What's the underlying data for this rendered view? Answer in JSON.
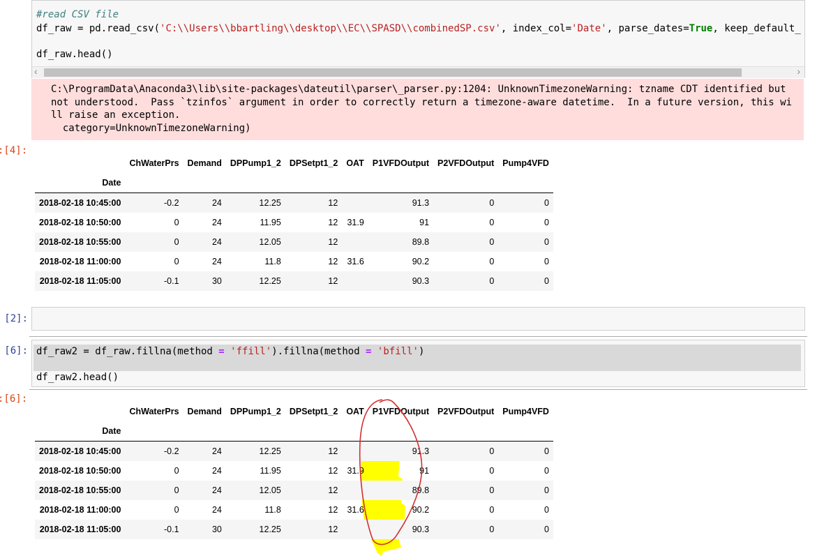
{
  "cell_read": {
    "comment": "#read CSV file",
    "line1_prefix": "df_raw = pd.read_csv(",
    "line1_path": "'C:\\\\Users\\\\bbartling\\\\desktop\\\\EC\\\\SPASD\\\\combinedSP.csv'",
    "line1_mid1": ", index_col=",
    "line1_index": "'Date'",
    "line1_mid2": ", parse_dates=",
    "line1_true": "True",
    "line1_mid3": ", keep_default_",
    "line2": "df_raw.head()",
    "scroll_right": "›",
    "scroll_left": "‹",
    "warning": "C:\\ProgramData\\Anaconda3\\lib\\site-packages\\dateutil\\parser\\_parser.py:1204: UnknownTimezoneWarning: tzname CDT identified but\nnot understood.  Pass `tzinfos` argument in order to correctly return a timezone-aware datetime.  In a future version, this wi\nll raise an exception.\n  category=UnknownTimezoneWarning)"
  },
  "out1_prompt": ":[4]:",
  "in2_prompt": "[2]:",
  "in3_prompt": "[6]:",
  "out3_prompt": ":[6]:",
  "cell_fill": {
    "line1_a": "df_raw2 = df_raw.fillna(method ",
    "line1_eq1": "=",
    "line1_b": " ",
    "line1_ffill": "'ffill'",
    "line1_c": ").fillna(method ",
    "line1_eq2": "=",
    "line1_d": " ",
    "line1_bfill": "'bfill'",
    "line1_e": ")",
    "line2": "df_raw2.head()"
  },
  "table_columns": [
    "ChWaterPrs",
    "Demand",
    "DPPump1_2",
    "DPSetpt1_2",
    "OAT",
    "P1VFDOutput",
    "P2VFDOutput",
    "Pump4VFD"
  ],
  "index_name": "Date",
  "table1": {
    "rows": [
      {
        "date": "2018-02-18 10:45:00",
        "cells": [
          "-0.2",
          "24",
          "12.25",
          "12",
          "",
          "91.3",
          "0",
          "0"
        ]
      },
      {
        "date": "2018-02-18 10:50:00",
        "cells": [
          "0",
          "24",
          "11.95",
          "12",
          "31.9",
          "91",
          "0",
          "0"
        ]
      },
      {
        "date": "2018-02-18 10:55:00",
        "cells": [
          "0",
          "24",
          "12.05",
          "12",
          "",
          "89.8",
          "0",
          "0"
        ]
      },
      {
        "date": "2018-02-18 11:00:00",
        "cells": [
          "0",
          "24",
          "11.8",
          "12",
          "31.6",
          "90.2",
          "0",
          "0"
        ]
      },
      {
        "date": "2018-02-18 11:05:00",
        "cells": [
          "-0.1",
          "30",
          "12.25",
          "12",
          "",
          "90.3",
          "0",
          "0"
        ]
      }
    ]
  },
  "table2": {
    "rows": [
      {
        "date": "2018-02-18 10:45:00",
        "cells": [
          "-0.2",
          "24",
          "12.25",
          "12",
          "",
          "91.3",
          "0",
          "0"
        ]
      },
      {
        "date": "2018-02-18 10:50:00",
        "cells": [
          "0",
          "24",
          "11.95",
          "12",
          "31.9",
          "91",
          "0",
          "0"
        ]
      },
      {
        "date": "2018-02-18 10:55:00",
        "cells": [
          "0",
          "24",
          "12.05",
          "12",
          "",
          "89.8",
          "0",
          "0"
        ]
      },
      {
        "date": "2018-02-18 11:00:00",
        "cells": [
          "0",
          "24",
          "11.8",
          "12",
          "31.6",
          "90.2",
          "0",
          "0"
        ]
      },
      {
        "date": "2018-02-18 11:05:00",
        "cells": [
          "-0.1",
          "30",
          "12.25",
          "12",
          "",
          "90.3",
          "0",
          "0"
        ]
      }
    ]
  },
  "annotation": {
    "highlight_color": "#ffff00",
    "circle_color": "#d32f2f"
  }
}
